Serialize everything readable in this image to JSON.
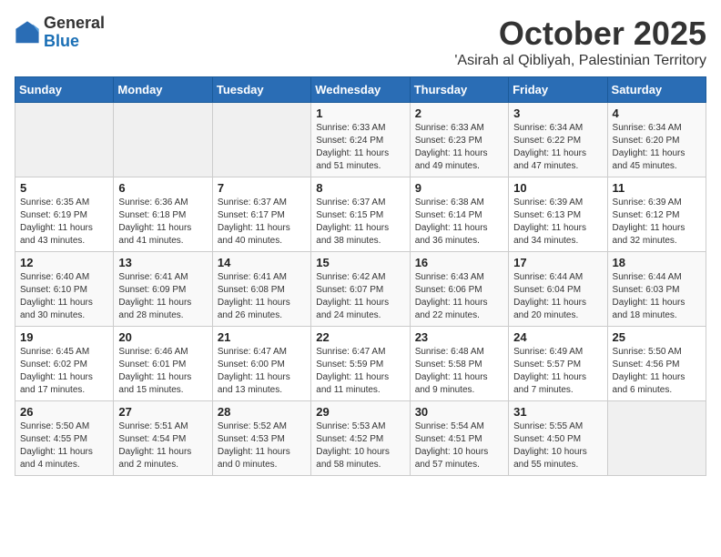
{
  "header": {
    "logo_general": "General",
    "logo_blue": "Blue",
    "month": "October 2025",
    "location": "'Asirah al Qibliyah, Palestinian Territory"
  },
  "weekdays": [
    "Sunday",
    "Monday",
    "Tuesday",
    "Wednesday",
    "Thursday",
    "Friday",
    "Saturday"
  ],
  "weeks": [
    [
      {
        "day": "",
        "text": ""
      },
      {
        "day": "",
        "text": ""
      },
      {
        "day": "",
        "text": ""
      },
      {
        "day": "1",
        "text": "Sunrise: 6:33 AM\nSunset: 6:24 PM\nDaylight: 11 hours\nand 51 minutes."
      },
      {
        "day": "2",
        "text": "Sunrise: 6:33 AM\nSunset: 6:23 PM\nDaylight: 11 hours\nand 49 minutes."
      },
      {
        "day": "3",
        "text": "Sunrise: 6:34 AM\nSunset: 6:22 PM\nDaylight: 11 hours\nand 47 minutes."
      },
      {
        "day": "4",
        "text": "Sunrise: 6:34 AM\nSunset: 6:20 PM\nDaylight: 11 hours\nand 45 minutes."
      }
    ],
    [
      {
        "day": "5",
        "text": "Sunrise: 6:35 AM\nSunset: 6:19 PM\nDaylight: 11 hours\nand 43 minutes."
      },
      {
        "day": "6",
        "text": "Sunrise: 6:36 AM\nSunset: 6:18 PM\nDaylight: 11 hours\nand 41 minutes."
      },
      {
        "day": "7",
        "text": "Sunrise: 6:37 AM\nSunset: 6:17 PM\nDaylight: 11 hours\nand 40 minutes."
      },
      {
        "day": "8",
        "text": "Sunrise: 6:37 AM\nSunset: 6:15 PM\nDaylight: 11 hours\nand 38 minutes."
      },
      {
        "day": "9",
        "text": "Sunrise: 6:38 AM\nSunset: 6:14 PM\nDaylight: 11 hours\nand 36 minutes."
      },
      {
        "day": "10",
        "text": "Sunrise: 6:39 AM\nSunset: 6:13 PM\nDaylight: 11 hours\nand 34 minutes."
      },
      {
        "day": "11",
        "text": "Sunrise: 6:39 AM\nSunset: 6:12 PM\nDaylight: 11 hours\nand 32 minutes."
      }
    ],
    [
      {
        "day": "12",
        "text": "Sunrise: 6:40 AM\nSunset: 6:10 PM\nDaylight: 11 hours\nand 30 minutes."
      },
      {
        "day": "13",
        "text": "Sunrise: 6:41 AM\nSunset: 6:09 PM\nDaylight: 11 hours\nand 28 minutes."
      },
      {
        "day": "14",
        "text": "Sunrise: 6:41 AM\nSunset: 6:08 PM\nDaylight: 11 hours\nand 26 minutes."
      },
      {
        "day": "15",
        "text": "Sunrise: 6:42 AM\nSunset: 6:07 PM\nDaylight: 11 hours\nand 24 minutes."
      },
      {
        "day": "16",
        "text": "Sunrise: 6:43 AM\nSunset: 6:06 PM\nDaylight: 11 hours\nand 22 minutes."
      },
      {
        "day": "17",
        "text": "Sunrise: 6:44 AM\nSunset: 6:04 PM\nDaylight: 11 hours\nand 20 minutes."
      },
      {
        "day": "18",
        "text": "Sunrise: 6:44 AM\nSunset: 6:03 PM\nDaylight: 11 hours\nand 18 minutes."
      }
    ],
    [
      {
        "day": "19",
        "text": "Sunrise: 6:45 AM\nSunset: 6:02 PM\nDaylight: 11 hours\nand 17 minutes."
      },
      {
        "day": "20",
        "text": "Sunrise: 6:46 AM\nSunset: 6:01 PM\nDaylight: 11 hours\nand 15 minutes."
      },
      {
        "day": "21",
        "text": "Sunrise: 6:47 AM\nSunset: 6:00 PM\nDaylight: 11 hours\nand 13 minutes."
      },
      {
        "day": "22",
        "text": "Sunrise: 6:47 AM\nSunset: 5:59 PM\nDaylight: 11 hours\nand 11 minutes."
      },
      {
        "day": "23",
        "text": "Sunrise: 6:48 AM\nSunset: 5:58 PM\nDaylight: 11 hours\nand 9 minutes."
      },
      {
        "day": "24",
        "text": "Sunrise: 6:49 AM\nSunset: 5:57 PM\nDaylight: 11 hours\nand 7 minutes."
      },
      {
        "day": "25",
        "text": "Sunrise: 5:50 AM\nSunset: 4:56 PM\nDaylight: 11 hours\nand 6 minutes."
      }
    ],
    [
      {
        "day": "26",
        "text": "Sunrise: 5:50 AM\nSunset: 4:55 PM\nDaylight: 11 hours\nand 4 minutes."
      },
      {
        "day": "27",
        "text": "Sunrise: 5:51 AM\nSunset: 4:54 PM\nDaylight: 11 hours\nand 2 minutes."
      },
      {
        "day": "28",
        "text": "Sunrise: 5:52 AM\nSunset: 4:53 PM\nDaylight: 11 hours\nand 0 minutes."
      },
      {
        "day": "29",
        "text": "Sunrise: 5:53 AM\nSunset: 4:52 PM\nDaylight: 10 hours\nand 58 minutes."
      },
      {
        "day": "30",
        "text": "Sunrise: 5:54 AM\nSunset: 4:51 PM\nDaylight: 10 hours\nand 57 minutes."
      },
      {
        "day": "31",
        "text": "Sunrise: 5:55 AM\nSunset: 4:50 PM\nDaylight: 10 hours\nand 55 minutes."
      },
      {
        "day": "",
        "text": ""
      }
    ]
  ]
}
